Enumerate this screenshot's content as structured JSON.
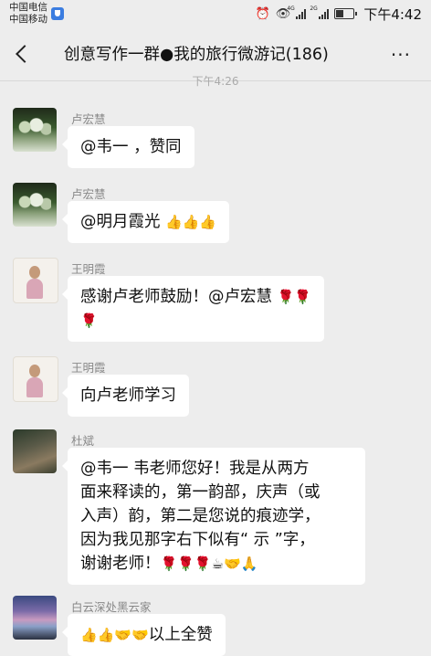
{
  "status_bar": {
    "carrier_1": "中国电信",
    "carrier_2": "中国移动",
    "network_1": "4G",
    "network_2": "2G",
    "time": "下午4:42",
    "icons": [
      "alarm-icon",
      "eye-icon",
      "signal-icon",
      "battery-icon"
    ]
  },
  "nav": {
    "title": "创意写作一群●我的旅行微游记(186)",
    "more_label": "···"
  },
  "timestamp": "下午4:26",
  "messages": [
    {
      "sender": "卢宏慧",
      "avatar": "tree-landscape",
      "text": "@韦一  ，赞同",
      "emoji": ""
    },
    {
      "sender": "卢宏慧",
      "avatar": "tree-landscape",
      "text": "@明月霞光  ",
      "emoji": "👍👍👍"
    },
    {
      "sender": "王明霞",
      "avatar": "woman-portrait",
      "text": "感谢卢老师鼓励！@卢宏慧  ",
      "emoji": "🌹🌹",
      "emoji_line2": "🌹"
    },
    {
      "sender": "王明霞",
      "avatar": "woman-portrait",
      "text": "向卢老师学习",
      "emoji": ""
    },
    {
      "sender": "杜斌",
      "avatar": "scene-photo",
      "lines": [
        "@韦一   韦老师您好！我是从两方",
        "面来释读的，第一韵部，庆声（或",
        "入声）韵，第二是您说的痕迹学，",
        "因为我见那字右下似有“ 示 ”字，",
        "谢谢老师！"
      ],
      "emoji": "🌹🌹🌹☕🤝🙏"
    },
    {
      "sender": "白云深处黑云家",
      "avatar": "sunset-lake",
      "text": "以上全赞",
      "emoji": "👍👍🤝🤝"
    }
  ]
}
